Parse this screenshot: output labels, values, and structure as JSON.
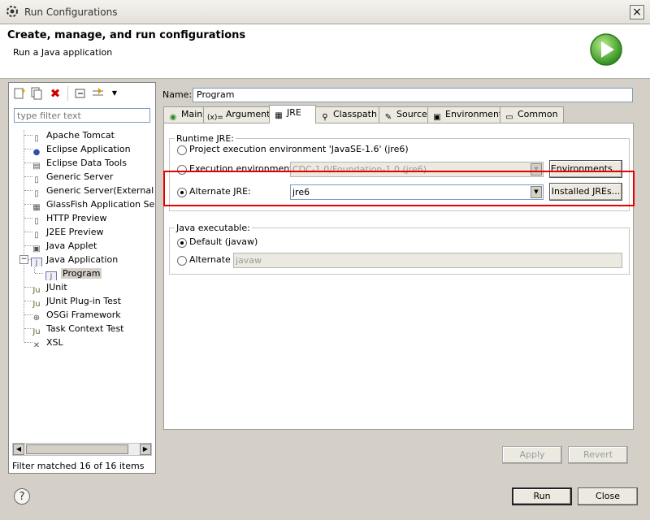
{
  "window": {
    "title": "Run Configurations",
    "close_icon": "×"
  },
  "banner": {
    "title": "Create, manage, and run configurations",
    "subtitle": "Run a Java application"
  },
  "left": {
    "toolbar_icons": [
      "new-config-icon",
      "duplicate-icon",
      "delete-icon",
      "collapse-all-icon",
      "filter-icon",
      "dropdown-icon"
    ],
    "filter_placeholder": "type filter text",
    "tree": [
      {
        "label": "Apache Tomcat",
        "icon": "tomcat-icon",
        "glyph": "▯"
      },
      {
        "label": "Eclipse Application",
        "icon": "eclipse-icon",
        "glyph": "●"
      },
      {
        "label": "Eclipse Data Tools",
        "icon": "database-icon",
        "glyph": "▤"
      },
      {
        "label": "Generic Server",
        "icon": "server-icon",
        "glyph": "▯"
      },
      {
        "label": "Generic Server(External La",
        "icon": "server-icon",
        "glyph": "▯"
      },
      {
        "label": "GlassFish Application Serve",
        "icon": "glassfish-icon",
        "glyph": "▦"
      },
      {
        "label": "HTTP Preview",
        "icon": "server-icon",
        "glyph": "▯"
      },
      {
        "label": "J2EE Preview",
        "icon": "server-icon",
        "glyph": "▯"
      },
      {
        "label": "Java Applet",
        "icon": "applet-icon",
        "glyph": "▣"
      },
      {
        "label": "Java Application",
        "icon": "java-app-icon",
        "glyph": "J",
        "expanded": true,
        "toggle": "−"
      },
      {
        "label": "Program",
        "icon": "java-app-icon",
        "glyph": "J",
        "child": true,
        "selected": true
      },
      {
        "label": "JUnit",
        "icon": "junit-icon",
        "glyph": "Ju"
      },
      {
        "label": "JUnit Plug-in Test",
        "icon": "junit-plugin-icon",
        "glyph": "Ju"
      },
      {
        "label": "OSGi Framework",
        "icon": "osgi-icon",
        "glyph": "⊕"
      },
      {
        "label": "Task Context Test",
        "icon": "task-context-icon",
        "glyph": "Ju"
      },
      {
        "label": "XSL",
        "icon": "xsl-icon",
        "glyph": "✕"
      }
    ],
    "scroll_left": "◀",
    "scroll_right": "▶",
    "filter_status": "Filter matched 16 of 16 items"
  },
  "config": {
    "name_label": "Name:",
    "name_value": "Program",
    "tabs": [
      {
        "label": "Main",
        "icon": "main-tab-icon",
        "glyph": "◉"
      },
      {
        "label": "Arguments",
        "icon": "arguments-tab-icon",
        "glyph": "(x)="
      },
      {
        "label": "JRE",
        "icon": "jre-tab-icon",
        "glyph": "▦",
        "active": true
      },
      {
        "label": "Classpath",
        "icon": "classpath-tab-icon",
        "glyph": "⚲"
      },
      {
        "label": "Source",
        "icon": "source-tab-icon",
        "glyph": "✎"
      },
      {
        "label": "Environment",
        "icon": "environment-tab-icon",
        "glyph": "▣"
      },
      {
        "label": "Common",
        "icon": "common-tab-icon",
        "glyph": "▭"
      }
    ],
    "runtime_jre": {
      "legend": "Runtime JRE:",
      "project_env_label": "Project execution environment 'JavaSE-1.6' (jre6)",
      "exec_env_label": "Execution environment:",
      "exec_env_value": "CDC-1.0/Foundation-1.0 (jre6)",
      "environments_button": "Environments...",
      "alternate_label": "Alternate JRE:",
      "alternate_value": "jre6",
      "installed_button": "Installed JREs...",
      "selected": "alternate"
    },
    "java_exec": {
      "legend": "Java executable:",
      "default_label": "Default (javaw)",
      "alternate_label": "Alternate",
      "alternate_value": "javaw",
      "selected": "default"
    },
    "apply_button": "Apply",
    "revert_button": "Revert"
  },
  "footer": {
    "help_icon": "?",
    "run_button": "Run",
    "close_button": "Close"
  },
  "colors": {
    "highlight": "#e60000",
    "run_logo": "#3fa32a"
  }
}
